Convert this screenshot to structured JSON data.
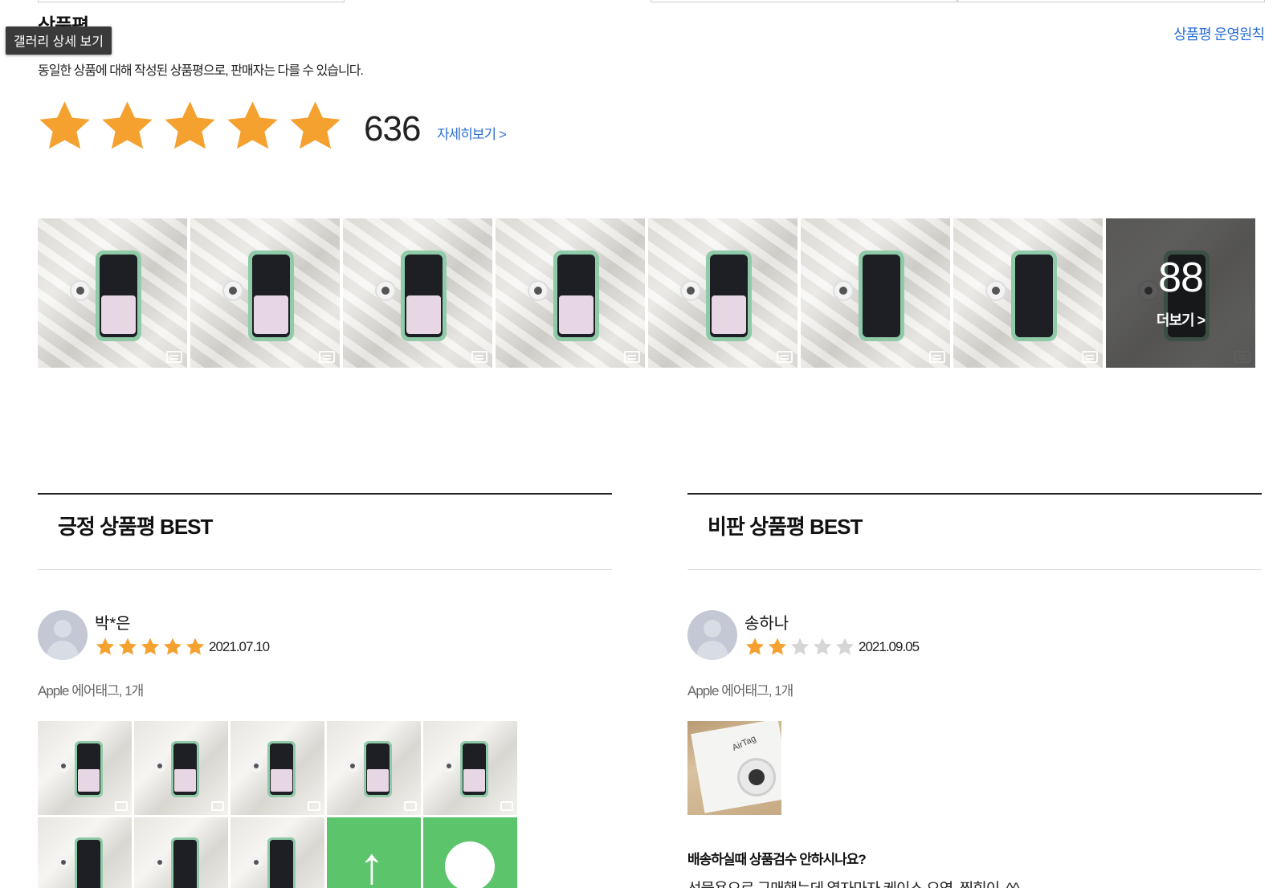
{
  "section": {
    "title": "상품평",
    "tooltip": "갤러리 상세 보기",
    "policy_link": "상품평 운영원칙",
    "subtitle": "동일한 상품에 대해 작성된 상품평으로, 판매자는 다를 수 있습니다."
  },
  "rating": {
    "stars_filled": 5,
    "stars_total": 5,
    "count": "636",
    "detail_link": "자세히보기 >"
  },
  "gallery": {
    "thumbnails": 8,
    "more_count": "88",
    "more_label": "더보기 >"
  },
  "positive_best": {
    "heading": "긍정 상품평 BEST",
    "reviewer": "박*은",
    "stars_filled": 5,
    "date": "2021.07.10",
    "product_option": "Apple 에어태그, 1개"
  },
  "negative_best": {
    "heading": "비판 상품평 BEST",
    "reviewer": "송하나",
    "stars_filled": 2,
    "date": "2021.09.05",
    "product_option": "Apple 에어태그, 1개",
    "photo_label": "AirTag",
    "headline": "배송하실때 상품검수 안하시나요?",
    "body": "선물용으로 구매했는데 열자마자 케이스 오염, 찍힘이..^^.."
  },
  "colors": {
    "star_on": "#F5A130",
    "star_off": "#D6D6D6",
    "link": "#2C6FD6"
  },
  "icons": [
    "star-icon",
    "comment-icon",
    "avatar-icon",
    "arrow-up-icon"
  ]
}
